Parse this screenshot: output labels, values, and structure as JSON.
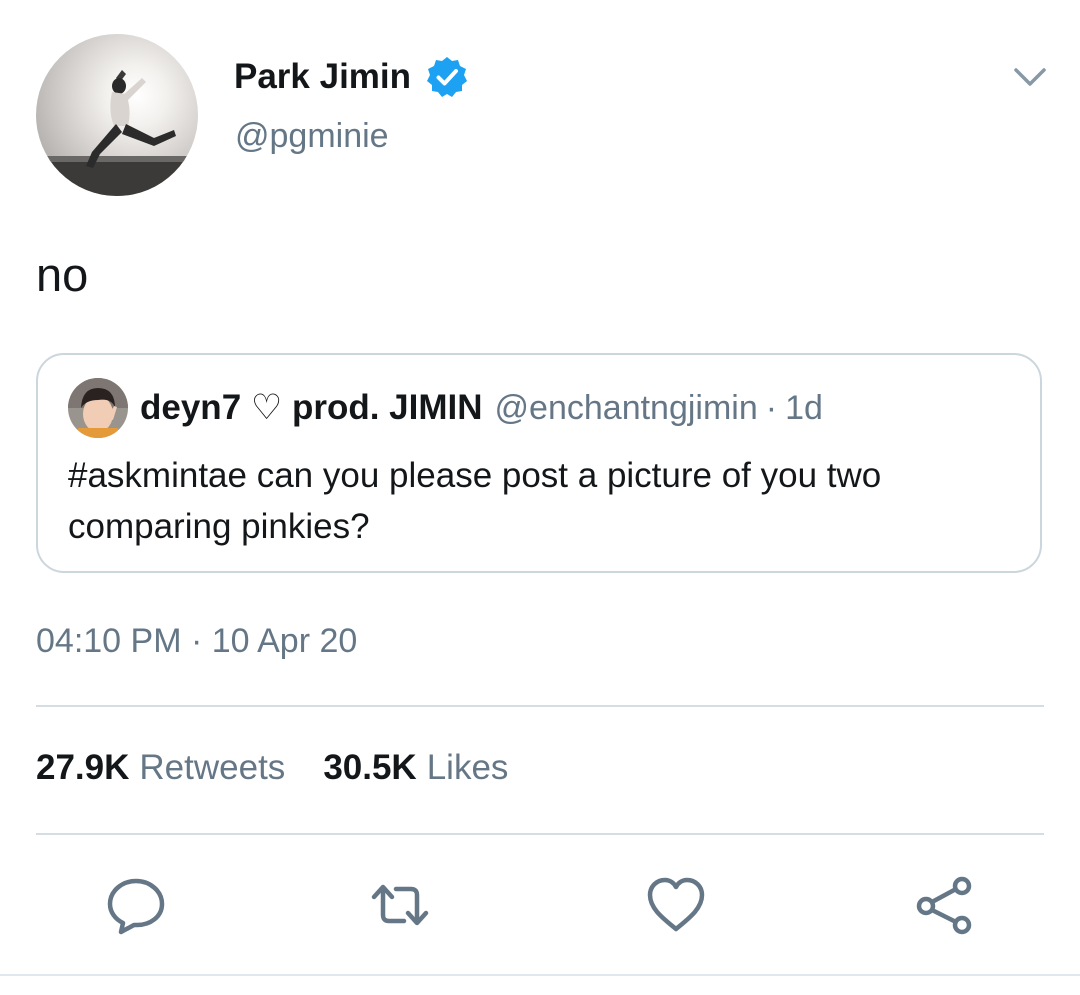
{
  "author": {
    "display_name": "Park Jimin",
    "handle": "@pgminie",
    "verified": true,
    "avatar_icon": "jumping-person-silhouette"
  },
  "tweet": {
    "text": "no",
    "timestamp": "04:10 PM · 10 Apr 20"
  },
  "quoted_tweet": {
    "display_name": "deyn7 ♡ prod. JIMIN",
    "handle": "@enchantngjimin",
    "separator": "·",
    "time": "1d",
    "text": "#askmintae can you please post a picture of you two comparing pinkies?"
  },
  "stats": {
    "retweets_count": "27.9K",
    "retweets_label": "Retweets",
    "likes_count": "30.5K",
    "likes_label": "Likes"
  },
  "actions": [
    "reply-icon",
    "retweet-icon",
    "like-icon",
    "share-icon"
  ],
  "colors": {
    "primary_text": "#14171a",
    "secondary_text": "#657786",
    "verified_blue": "#1da1f2",
    "border": "#ccd6dd"
  }
}
